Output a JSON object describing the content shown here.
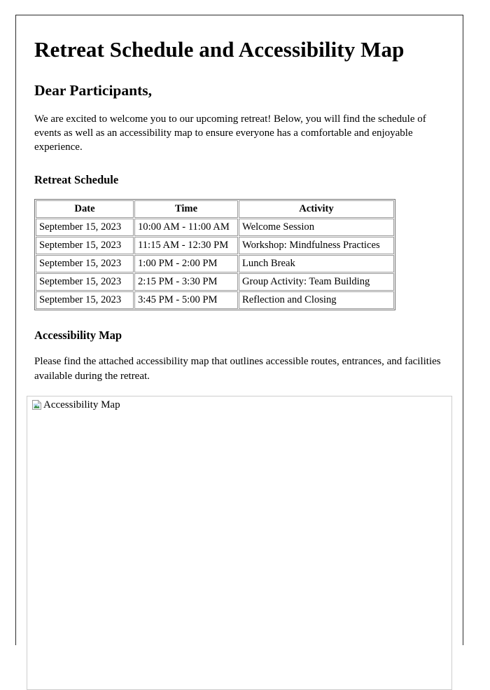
{
  "document": {
    "title": "Retreat Schedule and Accessibility Map",
    "salutation": "Dear Participants,",
    "intro_paragraph": "We are excited to welcome you to our upcoming retreat! Below, you will find the schedule of events as well as an accessibility map to ensure everyone has a comfortable and enjoyable experience."
  },
  "schedule": {
    "heading": "Retreat Schedule",
    "columns": [
      "Date",
      "Time",
      "Activity"
    ],
    "rows": [
      {
        "date": "September 15, 2023",
        "time": "10:00 AM - 11:00 AM",
        "activity": "Welcome Session"
      },
      {
        "date": "September 15, 2023",
        "time": "11:15 AM - 12:30 PM",
        "activity": "Workshop: Mindfulness Practices"
      },
      {
        "date": "September 15, 2023",
        "time": "1:00 PM - 2:00 PM",
        "activity": "Lunch Break"
      },
      {
        "date": "September 15, 2023",
        "time": "2:15 PM - 3:30 PM",
        "activity": "Group Activity: Team Building"
      },
      {
        "date": "September 15, 2023",
        "time": "3:45 PM - 5:00 PM",
        "activity": "Reflection and Closing"
      }
    ]
  },
  "accessibility": {
    "heading": "Accessibility Map",
    "paragraph": "Please find the attached accessibility map that outlines accessible routes, entrances, and facilities available during the retreat.",
    "image": {
      "alt_text": "Accessibility Map",
      "icon": "broken-image-icon",
      "state": "broken"
    }
  },
  "colors": {
    "page_border": "#2b2b2b",
    "table_border": "#9a9a9a",
    "image_box_border": "#cdcdcd",
    "text": "#000000",
    "icon_sky": "#b8d6ef",
    "icon_hill": "#3f9142",
    "icon_page": "#ffffff"
  }
}
